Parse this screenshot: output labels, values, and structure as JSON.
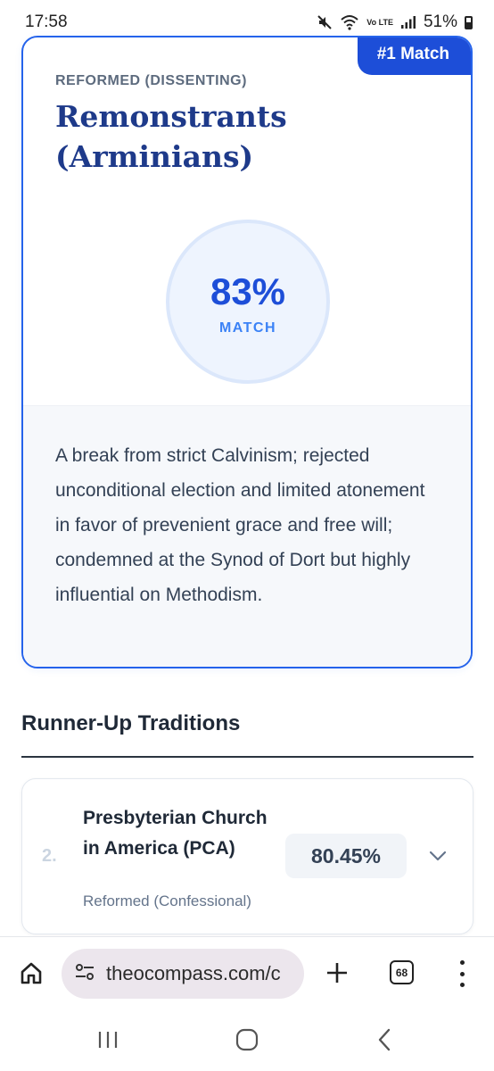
{
  "status_bar": {
    "time": "17:58",
    "battery": "51%",
    "icons": [
      "mute-icon",
      "wifi-icon",
      "volte-icon",
      "signal-icon",
      "battery-icon"
    ],
    "volte_label": "Vo LTE"
  },
  "top_match": {
    "badge": "#1 Match",
    "category": "REFORMED (DISSENTING)",
    "name": "Remonstrants (Arminians)",
    "score": "83%",
    "score_label": "MATCH",
    "score_value": 83,
    "description": "A break from strict Calvinism; rejected unconditional election and limited atonement in favor of prevenient grace and free will; condemned at the Synod of Dort but highly influential on Methodism."
  },
  "runner_up": {
    "title": "Runner-Up Traditions",
    "items": [
      {
        "rank": "2.",
        "name": "Presbyterian Church in America (PCA)",
        "category": "Reformed (Confessional)",
        "score": "80.45%"
      }
    ]
  },
  "browser": {
    "url": "theocompass.com/c",
    "tab_count": "68"
  },
  "colors": {
    "accent": "#2563eb",
    "badge": "#1d4ed8",
    "title": "#1e3a8a"
  }
}
